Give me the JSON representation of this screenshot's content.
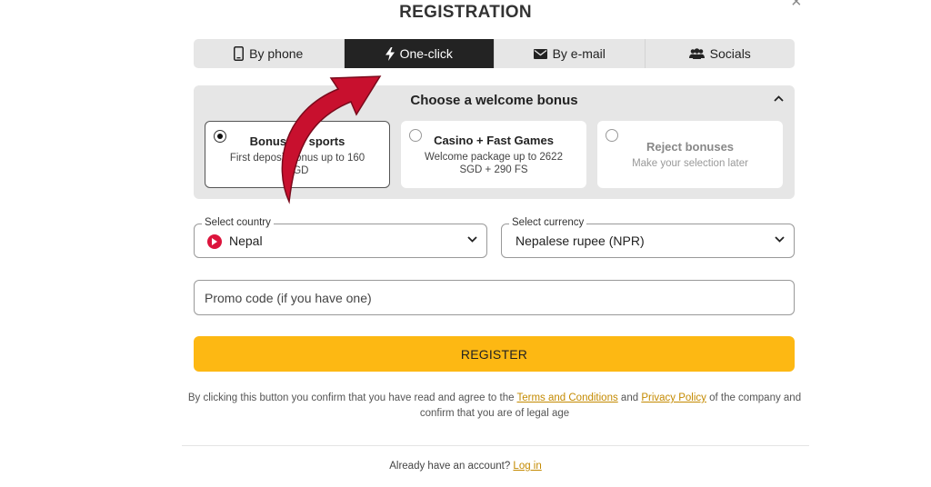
{
  "modal": {
    "title": "REGISTRATION",
    "close_symbol": "×"
  },
  "tabs": [
    {
      "label": "By phone",
      "icon": "phone-icon",
      "active": false
    },
    {
      "label": "One-click",
      "icon": "lightning-icon",
      "active": true
    },
    {
      "label": "By e-mail",
      "icon": "envelope-icon",
      "active": false
    },
    {
      "label": "Socials",
      "icon": "users-icon",
      "active": false
    }
  ],
  "bonus": {
    "heading": "Choose a welcome bonus",
    "options": [
      {
        "title": "Bonus for sports",
        "desc": "First deposit bonus up to 160 SGD",
        "selected": true
      },
      {
        "title": "Casino + Fast Games",
        "desc": "Welcome package up to 2622 SGD + 290 FS",
        "selected": false
      },
      {
        "title": "Reject bonuses",
        "desc": "Make your selection later",
        "selected": false
      }
    ]
  },
  "country": {
    "label": "Select country",
    "value": "Nepal"
  },
  "currency": {
    "label": "Select currency",
    "value": "Nepalese rupee (NPR)"
  },
  "promo": {
    "placeholder": "Promo code (if you have one)"
  },
  "register_button": "REGISTER",
  "legal": {
    "before": "By clicking this button you confirm that you have read and agree to the ",
    "terms_link": "Terms and Conditions",
    "and": " and ",
    "privacy_link": "Privacy Policy",
    "after": " of the company and confirm that you are of legal age"
  },
  "footer": {
    "question": "Already have an account? ",
    "login_link": "Log in"
  },
  "colors": {
    "accent": "#fdb813",
    "active_tab": "#232323",
    "link": "#c48a00",
    "arrow": "#c8102e"
  }
}
